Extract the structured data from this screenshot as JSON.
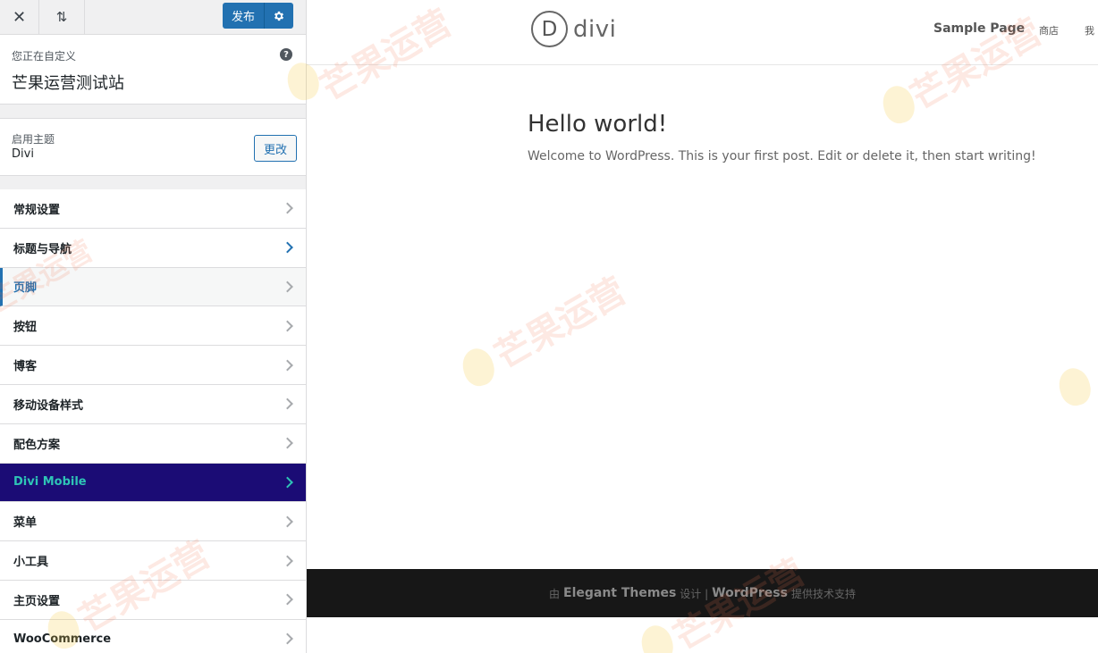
{
  "topbar": {
    "close_icon": "close-icon",
    "sort_icon": "up-down-arrows-icon",
    "publish_label": "发布",
    "settings_icon": "gear-icon"
  },
  "info": {
    "customizing_label": "您正在自定义",
    "site_title": "芒果运营测试站",
    "help_icon": "help-icon"
  },
  "theme": {
    "active_label": "启用主题",
    "name": "Divi",
    "change_label": "更改"
  },
  "menu": {
    "items": [
      {
        "label": "常规设置"
      },
      {
        "label": "标题与导航"
      },
      {
        "label": "页脚"
      },
      {
        "label": "按钮"
      },
      {
        "label": "博客"
      },
      {
        "label": "移动设备样式"
      },
      {
        "label": "配色方案"
      },
      {
        "label": "Divi Mobile"
      },
      {
        "label": "菜单"
      },
      {
        "label": "小工具"
      },
      {
        "label": "主页设置"
      },
      {
        "label": "WooCommerce"
      }
    ]
  },
  "preview": {
    "logo_letter": "D",
    "logo_text": "divi",
    "nav": [
      "Sample Page",
      "商店",
      "我"
    ],
    "post_title": "Hello world!",
    "post_text": "Welcome to WordPress. This is your first post. Edit or delete it, then start writing!",
    "footer": {
      "prefix": "由",
      "brand1": "Elegant Themes",
      "mid": "设计 |",
      "brand2": "WordPress",
      "suffix": "提供技术支持"
    }
  },
  "watermark": "芒果运营",
  "colors": {
    "accent": "#2271b1",
    "divi_mobile_bg": "#1b0c75",
    "divi_mobile_text": "#2ec4b6",
    "footer_bg": "#171717"
  }
}
